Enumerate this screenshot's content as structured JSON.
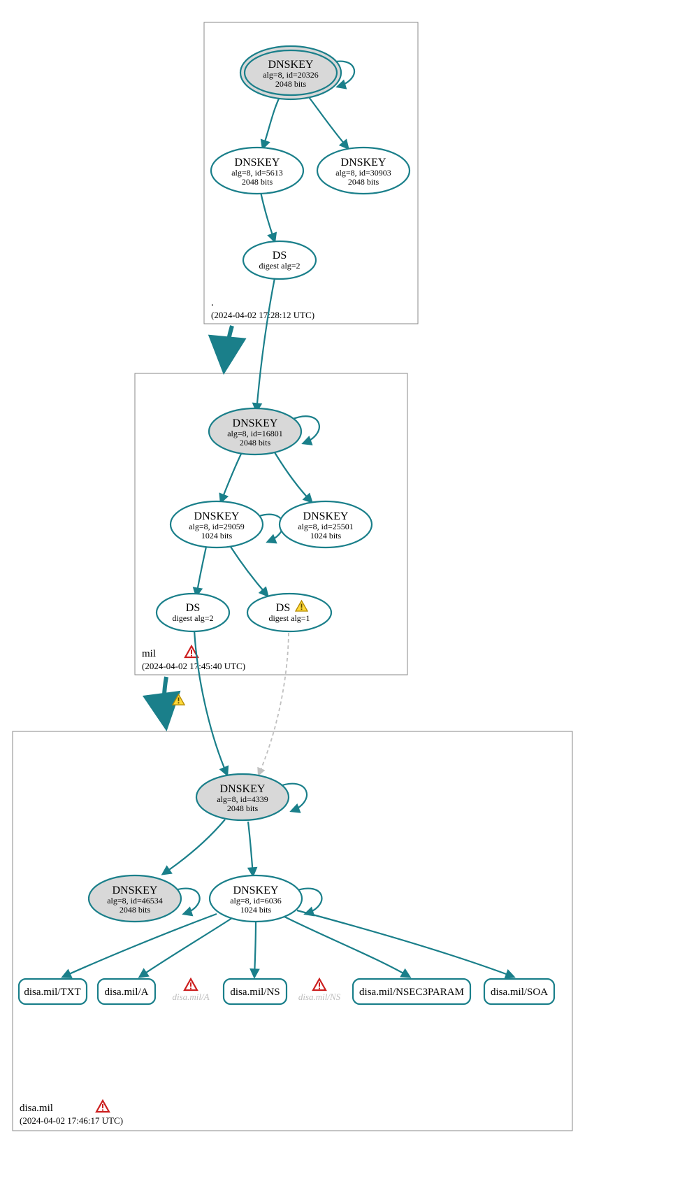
{
  "zones": [
    {
      "name": ".",
      "timestamp": "(2024-04-02 17:28:12 UTC)",
      "error": false
    },
    {
      "name": "mil",
      "timestamp": "(2024-04-02 17:45:40 UTC)",
      "error": true
    },
    {
      "name": "disa.mil",
      "timestamp": "(2024-04-02 17:46:17 UTC)",
      "error": true
    }
  ],
  "nodes": {
    "root_ksk": {
      "title": "DNSKEY",
      "line1": "alg=8, id=20326",
      "line2": "2048 bits"
    },
    "root_zsk1": {
      "title": "DNSKEY",
      "line1": "alg=8, id=5613",
      "line2": "2048 bits"
    },
    "root_zsk2": {
      "title": "DNSKEY",
      "line1": "alg=8, id=30903",
      "line2": "2048 bits"
    },
    "root_ds": {
      "title": "DS",
      "line1": "digest alg=2"
    },
    "mil_ksk": {
      "title": "DNSKEY",
      "line1": "alg=8, id=16801",
      "line2": "2048 bits"
    },
    "mil_zsk1": {
      "title": "DNSKEY",
      "line1": "alg=8, id=29059",
      "line2": "1024 bits"
    },
    "mil_zsk2": {
      "title": "DNSKEY",
      "line1": "alg=8, id=25501",
      "line2": "1024 bits"
    },
    "mil_ds2": {
      "title": "DS",
      "line1": "digest alg=2"
    },
    "mil_ds1": {
      "title": "DS",
      "line1": "digest alg=1"
    },
    "disa_ksk": {
      "title": "DNSKEY",
      "line1": "alg=8, id=4339",
      "line2": "2048 bits"
    },
    "disa_zsk_old": {
      "title": "DNSKEY",
      "line1": "alg=8, id=46534",
      "line2": "2048 bits"
    },
    "disa_zsk": {
      "title": "DNSKEY",
      "line1": "alg=8, id=6036",
      "line2": "1024 bits"
    }
  },
  "records": {
    "txt": "disa.mil/TXT",
    "a": "disa.mil/A",
    "ns": "disa.mil/NS",
    "nsec3": "disa.mil/NSEC3PARAM",
    "soa": "disa.mil/SOA"
  },
  "missing": {
    "a": "disa.mil/A",
    "ns": "disa.mil/NS"
  }
}
